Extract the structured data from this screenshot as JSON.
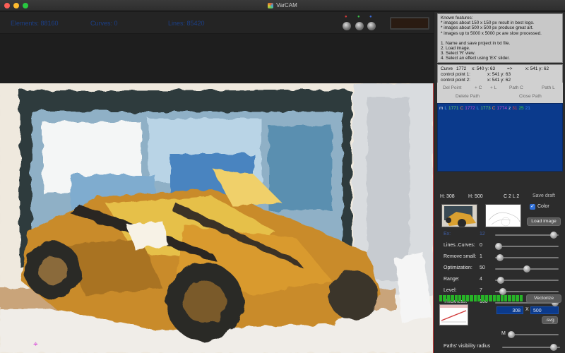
{
  "window": {
    "title": "VarCAM"
  },
  "topbar": {
    "elements": "Elements: 88160",
    "curves": "Curves: 0",
    "lines": "Lines: 85420",
    "dot_colors": [
      "#d63a3a",
      "#3ac24a",
      "#3a6ad6"
    ]
  },
  "features": {
    "lines": [
      "Known features:",
      "* images about 150 x 150 px result in best logo.",
      "* images about 500 x 500 px produce great art.",
      "* images up to 5000 x 5000 px are slow processed.",
      "",
      "1. Name and save project in txt file.",
      "2. Load image.",
      "3. Select 'R' view.",
      "4. Select an effect using 'EX' slider."
    ]
  },
  "curve_info": {
    "curve_label": "Curve",
    "curve_num": "1772",
    "curve_xy": "x: 540 y: 63",
    "arrow": "=>",
    "curve_to": "x: 541 y: 62",
    "cp1_label": "control point 1:",
    "cp1": "x: 541 y: 63",
    "cp2_label": "control point 2:",
    "cp2": "x: 541 y: 62"
  },
  "path_buttons": {
    "del_point": "Del Point",
    "add_c": "+ C",
    "add_l": "+ L",
    "path_c": "Path C",
    "path_l": "Path L",
    "delete_path": "Delete Path",
    "close_path": "Close Path"
  },
  "sequence": [
    {
      "t": "m",
      "c": "#e8e8e8"
    },
    {
      "t": "L",
      "c": "#4aa8ff"
    },
    {
      "t": "1771",
      "c": "#6ad46a"
    },
    {
      "t": "C",
      "c": "#ff8a3a"
    },
    {
      "t": "1772",
      "c": "#c44ad4"
    },
    {
      "t": "L",
      "c": "#4aa8ff"
    },
    {
      "t": "1773",
      "c": "#6ad46a"
    },
    {
      "t": "C",
      "c": "#ff8a3a"
    },
    {
      "t": "1774",
      "c": "#c44ad4"
    },
    {
      "t": "z",
      "c": "#e8e8e8"
    },
    {
      "t": "31",
      "c": "#e83a3a"
    },
    {
      "t": "25",
      "c": "#3ad43a"
    },
    {
      "t": "21",
      "c": "#3a8aff"
    }
  ],
  "image_info": {
    "h": "H: 308",
    "w": "H: 500",
    "c2l2": "C 2 L 2",
    "save_draft": "Save draft",
    "color_label": "Color",
    "color_checked": "✓",
    "load_image": "Load image"
  },
  "sliders": [
    {
      "label": "Ex:",
      "value": "12",
      "level": 0.97,
      "dim": true
    },
    {
      "label": "Lines..Curves:",
      "value": "0",
      "level": 0.0
    },
    {
      "label": "Remove small:",
      "value": "1",
      "level": 0.02
    },
    {
      "label": "Optimization:",
      "value": "50",
      "level": 0.5
    },
    {
      "label": "Range:",
      "value": "4",
      "level": 0.04
    },
    {
      "label": "Level:",
      "value": "7",
      "level": 0.07
    },
    {
      "label": "Thickness:",
      "value": "100",
      "level": 1.0
    }
  ],
  "vectorize": {
    "button": "Vectorize",
    "progress": 1.0
  },
  "size_fields": {
    "width": "308",
    "x_label": "X",
    "height": "500",
    "svg_button": ".svg"
  },
  "m_slider": {
    "label": "M",
    "level": 0.0
  },
  "visibility": {
    "label": "Paths' visibility radius",
    "level": 0.95
  },
  "colors": {
    "blue_panel": "#0b3a8c",
    "progress_green": "#27b427"
  }
}
